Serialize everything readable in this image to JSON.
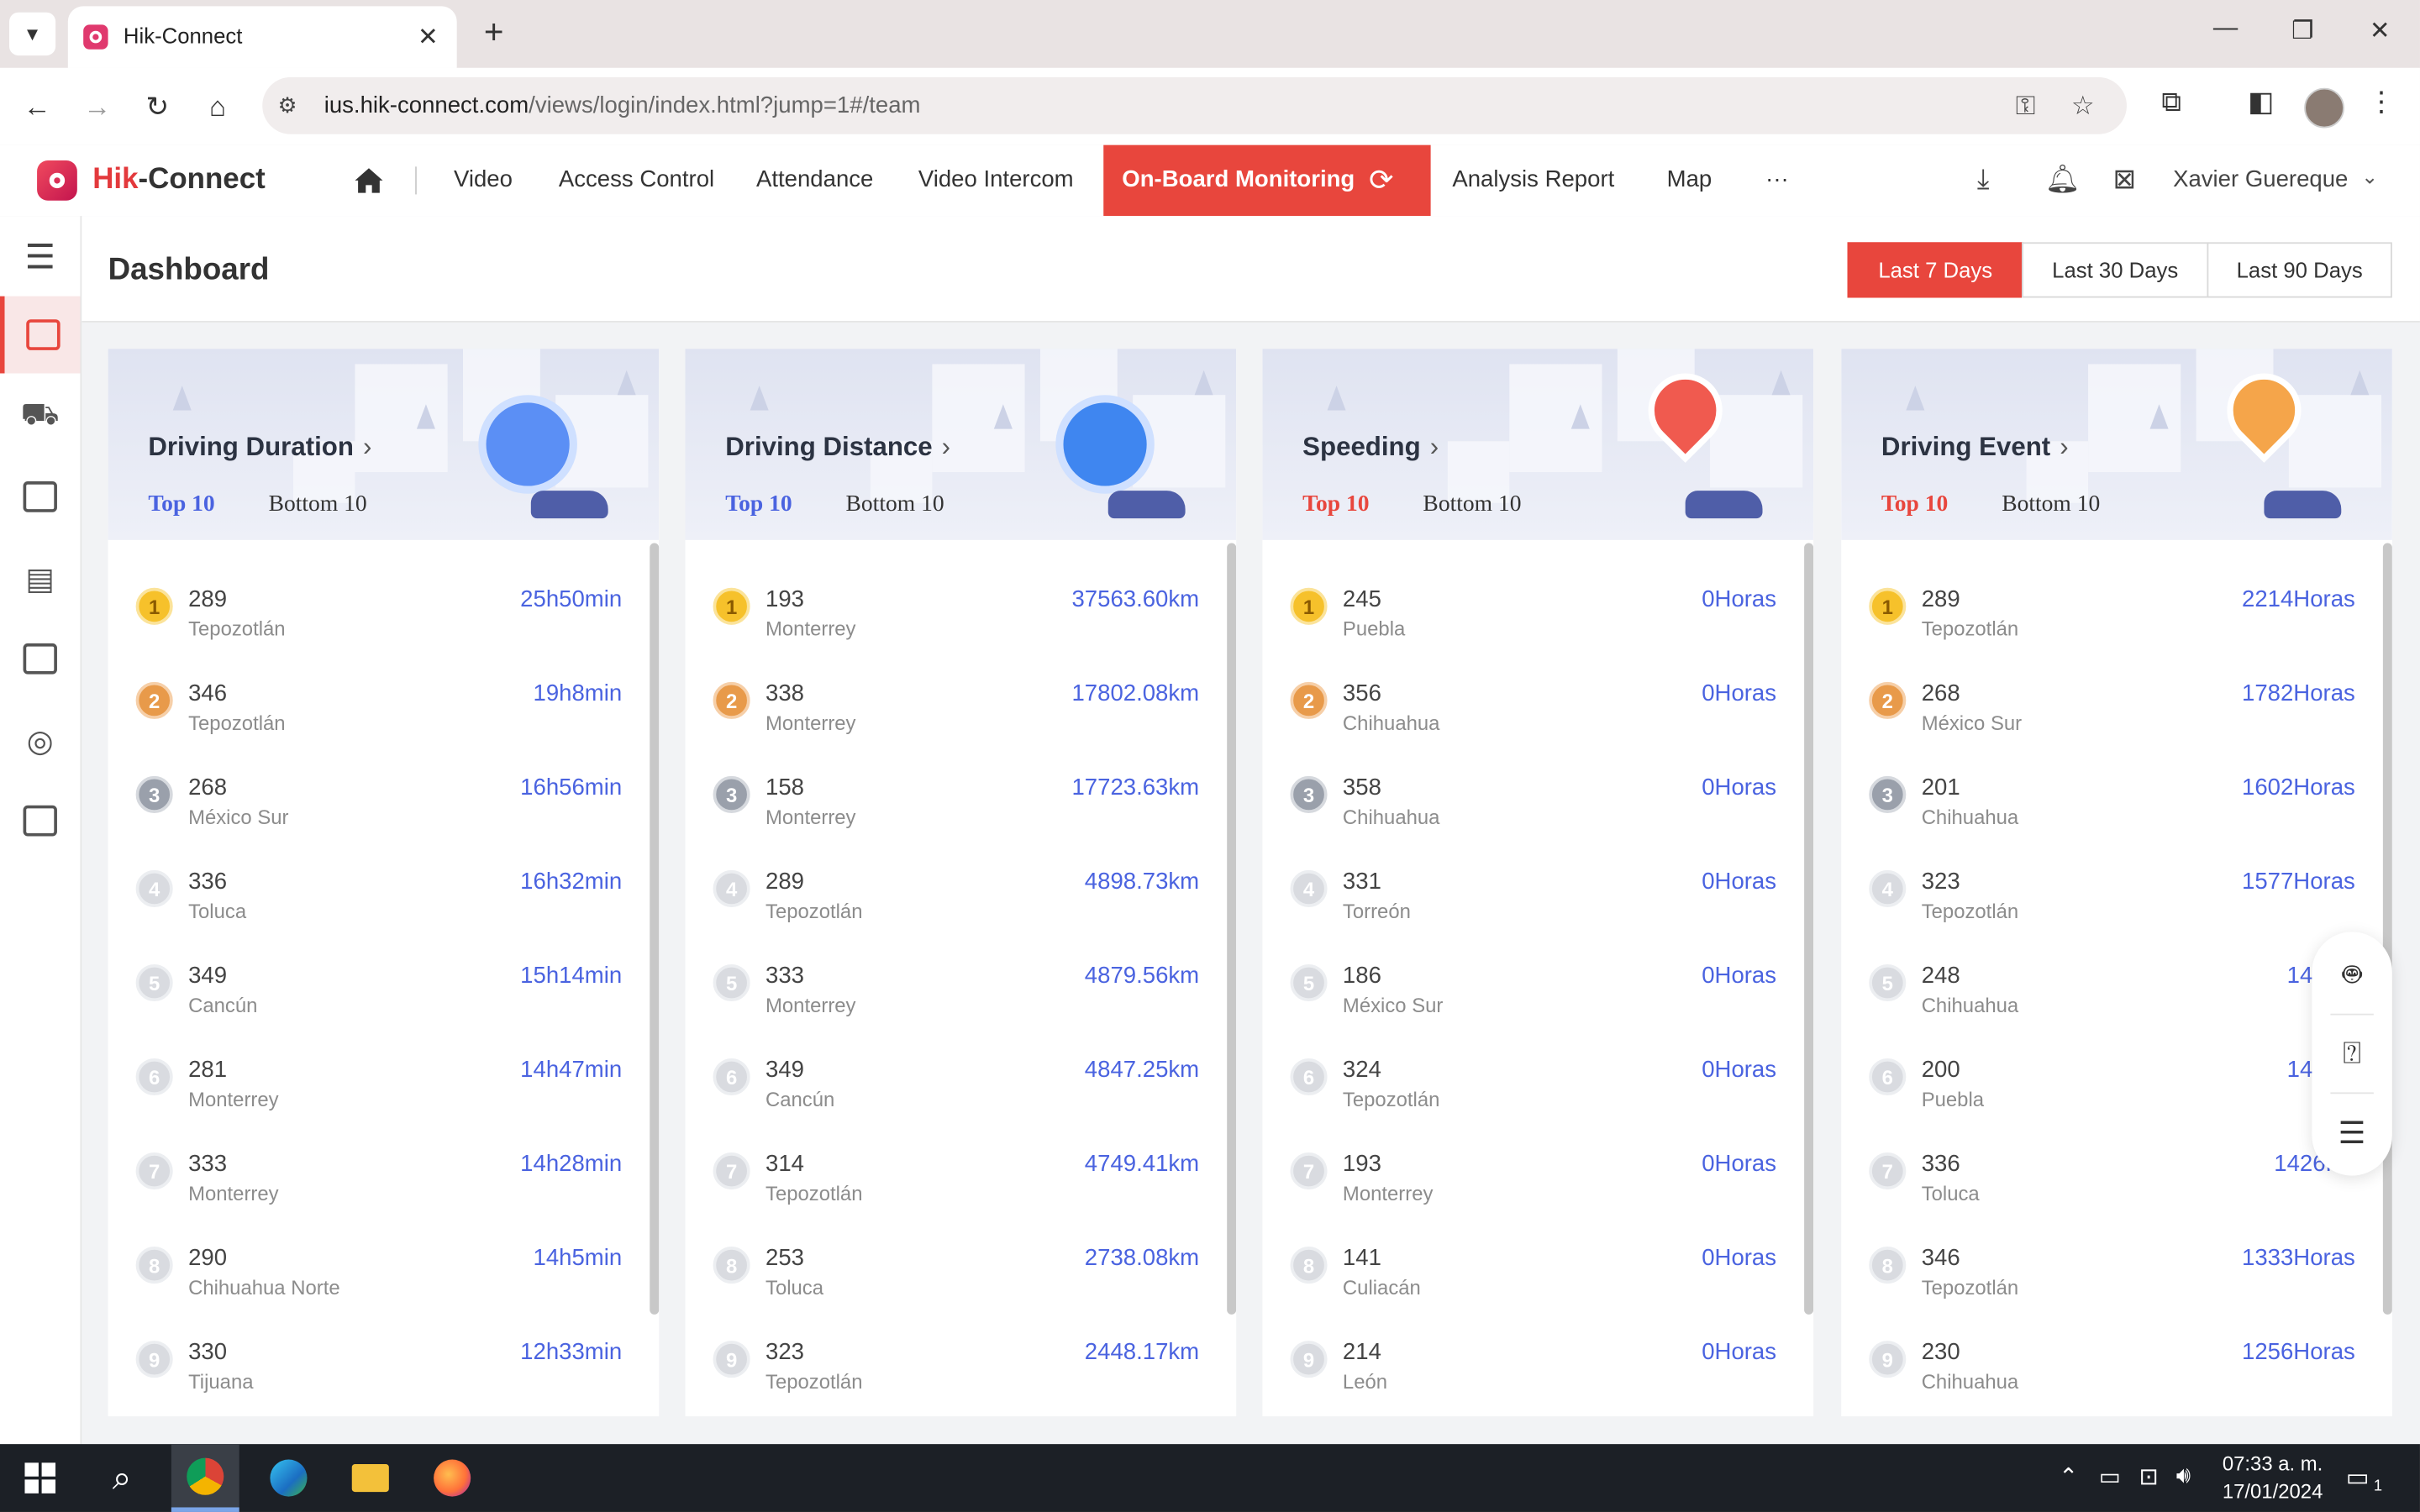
{
  "browser": {
    "tab_title": "Hik-Connect",
    "url_host": "ius.hik-connect.com",
    "url_path": "/views/login/index.html?jump=1#/team",
    "tab_close": "✕",
    "new_tab": "+",
    "minimize": "—",
    "restore": "❐",
    "close": "✕"
  },
  "app": {
    "logo_hik": "Hik",
    "logo_rest": "-Connect",
    "nav": [
      "Video",
      "Access Control",
      "Attendance",
      "Video Intercom",
      "On-Board Monitoring",
      "Analysis Report",
      "Map",
      "···"
    ],
    "user": "Xavier Guereque"
  },
  "dashboard": {
    "title": "Dashboard",
    "ranges": [
      "Last 7 Days",
      "Last 30 Days",
      "Last 90 Days"
    ],
    "active_range": "Last 7 Days"
  },
  "colors": {
    "accent": "#e8463d",
    "value_blue": "#4a63e0",
    "tab_blue": "#4a63e0",
    "tab_red": "#e8463d"
  },
  "cards": [
    {
      "title": "Driving Duration",
      "top_tab": "Top 10",
      "bottom_tab": "Bottom 10",
      "rows": [
        {
          "rank": "1",
          "id": "289",
          "loc": "Tepozotlán",
          "value": "25h50min"
        },
        {
          "rank": "2",
          "id": "346",
          "loc": "Tepozotlán",
          "value": "19h8min"
        },
        {
          "rank": "3",
          "id": "268",
          "loc": "México Sur",
          "value": "16h56min"
        },
        {
          "rank": "4",
          "id": "336",
          "loc": "Toluca",
          "value": "16h32min"
        },
        {
          "rank": "5",
          "id": "349",
          "loc": "Cancún",
          "value": "15h14min"
        },
        {
          "rank": "6",
          "id": "281",
          "loc": "Monterrey",
          "value": "14h47min"
        },
        {
          "rank": "7",
          "id": "333",
          "loc": "Monterrey",
          "value": "14h28min"
        },
        {
          "rank": "8",
          "id": "290",
          "loc": "Chihuahua Norte",
          "value": "14h5min"
        },
        {
          "rank": "9",
          "id": "330",
          "loc": "Tijuana",
          "value": "12h33min"
        }
      ]
    },
    {
      "title": "Driving Distance",
      "top_tab": "Top 10",
      "bottom_tab": "Bottom 10",
      "rows": [
        {
          "rank": "1",
          "id": "193",
          "loc": "Monterrey",
          "value": "37563.60km"
        },
        {
          "rank": "2",
          "id": "338",
          "loc": "Monterrey",
          "value": "17802.08km"
        },
        {
          "rank": "3",
          "id": "158",
          "loc": "Monterrey",
          "value": "17723.63km"
        },
        {
          "rank": "4",
          "id": "289",
          "loc": "Tepozotlán",
          "value": "4898.73km"
        },
        {
          "rank": "5",
          "id": "333",
          "loc": "Monterrey",
          "value": "4879.56km"
        },
        {
          "rank": "6",
          "id": "349",
          "loc": "Cancún",
          "value": "4847.25km"
        },
        {
          "rank": "7",
          "id": "314",
          "loc": "Tepozotlán",
          "value": "4749.41km"
        },
        {
          "rank": "8",
          "id": "253",
          "loc": "Toluca",
          "value": "2738.08km"
        },
        {
          "rank": "9",
          "id": "323",
          "loc": "Tepozotlán",
          "value": "2448.17km"
        }
      ]
    },
    {
      "title": "Speeding",
      "top_tab": "Top 10",
      "bottom_tab": "Bottom 10",
      "rows": [
        {
          "rank": "1",
          "id": "245",
          "loc": "Puebla",
          "value": "0Horas"
        },
        {
          "rank": "2",
          "id": "356",
          "loc": "Chihuahua",
          "value": "0Horas"
        },
        {
          "rank": "3",
          "id": "358",
          "loc": "Chihuahua",
          "value": "0Horas"
        },
        {
          "rank": "4",
          "id": "331",
          "loc": "Torreón",
          "value": "0Horas"
        },
        {
          "rank": "5",
          "id": "186",
          "loc": "México Sur",
          "value": "0Horas"
        },
        {
          "rank": "6",
          "id": "324",
          "loc": "Tepozotlán",
          "value": "0Horas"
        },
        {
          "rank": "7",
          "id": "193",
          "loc": "Monterrey",
          "value": "0Horas"
        },
        {
          "rank": "8",
          "id": "141",
          "loc": "Culiacán",
          "value": "0Horas"
        },
        {
          "rank": "9",
          "id": "214",
          "loc": "León",
          "value": "0Horas"
        }
      ]
    },
    {
      "title": "Driving Event",
      "top_tab": "Top 10",
      "bottom_tab": "Bottom 10",
      "rows": [
        {
          "rank": "1",
          "id": "289",
          "loc": "Tepozotlán",
          "value": "2214Horas"
        },
        {
          "rank": "2",
          "id": "268",
          "loc": "México Sur",
          "value": "1782Horas"
        },
        {
          "rank": "3",
          "id": "201",
          "loc": "Chihuahua",
          "value": "1602Horas"
        },
        {
          "rank": "4",
          "id": "323",
          "loc": "Tepozotlán",
          "value": "1577Horas"
        },
        {
          "rank": "5",
          "id": "248",
          "loc": "Chihuahua",
          "value": "1470H"
        },
        {
          "rank": "6",
          "id": "200",
          "loc": "Puebla",
          "value": "1440H"
        },
        {
          "rank": "7",
          "id": "336",
          "loc": "Toluca",
          "value": "1426Ho"
        },
        {
          "rank": "8",
          "id": "346",
          "loc": "Tepozotlán",
          "value": "1333Horas"
        },
        {
          "rank": "9",
          "id": "230",
          "loc": "Chihuahua",
          "value": "1256Horas"
        }
      ]
    }
  ],
  "taskbar": {
    "time": "07:33 a. m.",
    "date": "17/01/2024",
    "notification_count": "1"
  }
}
